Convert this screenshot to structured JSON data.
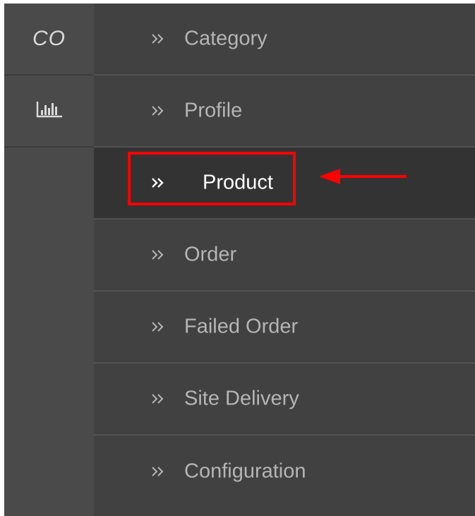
{
  "rail": {
    "logo_text": "CO",
    "report_icon": "bar-chart-icon"
  },
  "menu": {
    "items": [
      {
        "label": "Category",
        "icon": "double-chevron-right-icon"
      },
      {
        "label": "Profile",
        "icon": "double-chevron-right-icon"
      },
      {
        "label": "Product",
        "icon": "double-chevron-right-icon",
        "active": true
      },
      {
        "label": "Order",
        "icon": "double-chevron-right-icon"
      },
      {
        "label": "Failed Order",
        "icon": "double-chevron-right-icon"
      },
      {
        "label": "Site Delivery",
        "icon": "double-chevron-right-icon"
      },
      {
        "label": "Configuration",
        "icon": "double-chevron-right-icon"
      }
    ]
  },
  "annotation": {
    "highlight_color": "#ff0000",
    "arrow_color": "#ff0000"
  },
  "colors": {
    "menu_bg": "#414141",
    "rail_bg": "#4a4a4a",
    "active_bg": "#333333",
    "label_color": "#b5b5b5",
    "active_label_color": "#ffffff"
  }
}
